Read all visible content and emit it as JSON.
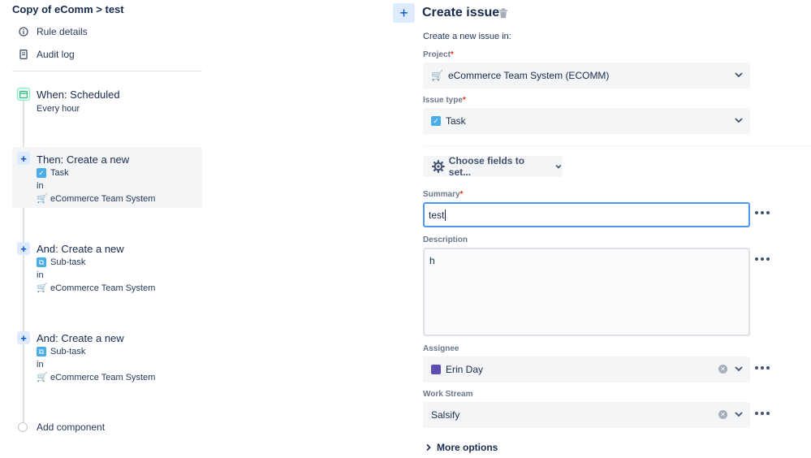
{
  "left": {
    "breadcrumb": "Copy of eComm > test",
    "nav": [
      {
        "label": "Rule details",
        "icon": "info-icon"
      },
      {
        "label": "Audit log",
        "icon": "document-icon"
      }
    ],
    "components": [
      {
        "title": "When: Scheduled",
        "detail": "Every hour",
        "icon": "calendar-icon"
      },
      {
        "title": "Then: Create a new",
        "type": "Task",
        "in": "in",
        "project": "eCommerce Team System",
        "icon": "plus-icon"
      },
      {
        "title": "And: Create a new",
        "type": "Sub-task",
        "in": "in",
        "project": "eCommerce Team System",
        "icon": "plus-icon"
      },
      {
        "title": "And: Create a new",
        "type": "Sub-task",
        "in": "in",
        "project": "eCommerce Team System",
        "icon": "plus-icon"
      }
    ],
    "add_component": "Add component"
  },
  "right": {
    "title": "Create issue",
    "subtitle": "Create a new issue in:",
    "project": {
      "label": "Project",
      "required": "*",
      "value": "eCommerce Team System (ECOMM)"
    },
    "issue_type": {
      "label": "Issue type",
      "required": "*",
      "value": "Task"
    },
    "choose_fields": "Choose fields to set...",
    "summary": {
      "label": "Summary",
      "required": "*",
      "value": "test"
    },
    "description": {
      "label": "Description",
      "value": "h"
    },
    "assignee": {
      "label": "Assignee",
      "value": "Erin Day"
    },
    "work_stream": {
      "label": "Work Stream",
      "value": "Salsify"
    },
    "more_options": "More options"
  },
  "colors": {
    "accent": "#0052cc",
    "focus": "#4c9aff",
    "field_bg": "#f4f5f7",
    "required": "#de350b"
  }
}
